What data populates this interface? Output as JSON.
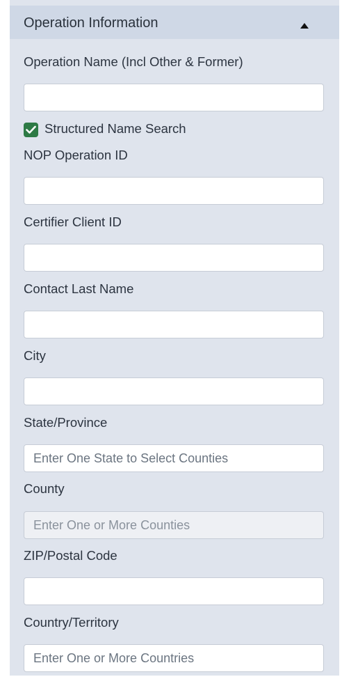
{
  "panel": {
    "title": "Operation Information",
    "collapse_icon": "triangle-up-icon"
  },
  "fields": {
    "operation_name": {
      "label": "Operation Name (Incl Other & Former)",
      "value": "",
      "placeholder": ""
    },
    "structured_search": {
      "label": "Structured Name Search",
      "checked": true,
      "color": "#2d7a45"
    },
    "nop_operation_id": {
      "label": "NOP Operation ID",
      "value": "",
      "placeholder": ""
    },
    "certifier_client_id": {
      "label": "Certifier Client ID",
      "value": "",
      "placeholder": ""
    },
    "contact_last_name": {
      "label": "Contact Last Name",
      "value": "",
      "placeholder": ""
    },
    "city": {
      "label": "City",
      "value": "",
      "placeholder": ""
    },
    "state_province": {
      "label": "State/Province",
      "value": "",
      "placeholder": "Enter One State to Select Counties"
    },
    "county": {
      "label": "County",
      "value": "",
      "placeholder": "Enter One or More Counties",
      "disabled": true
    },
    "zip_postal_code": {
      "label": "ZIP/Postal Code",
      "value": "",
      "placeholder": ""
    },
    "country_territory": {
      "label": "Country/Territory",
      "value": "",
      "placeholder": "Enter One or More Countries"
    }
  }
}
